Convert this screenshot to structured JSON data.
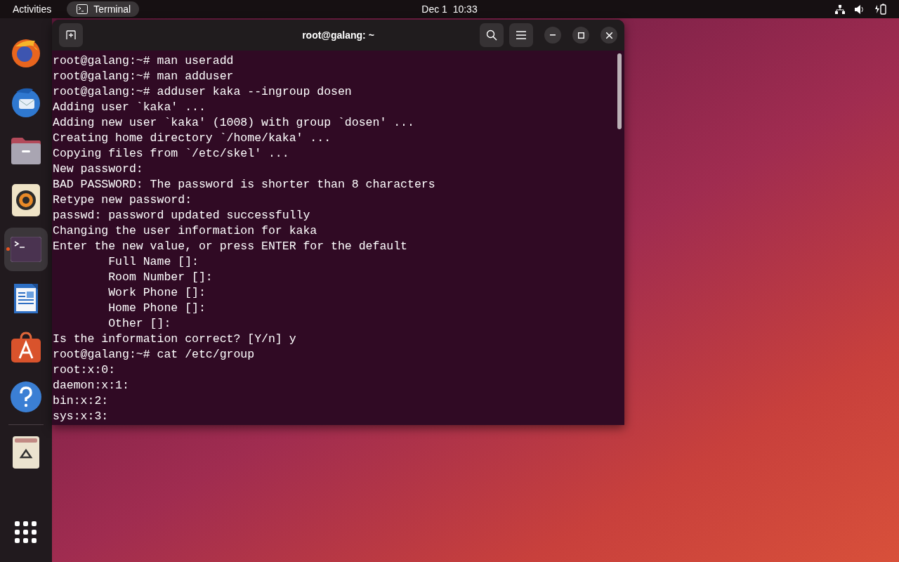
{
  "top_bar": {
    "activities": "Activities",
    "app": {
      "name": "Terminal"
    },
    "clock": "Dec 1  10:33"
  },
  "dock": {
    "items": [
      {
        "kind": "browser",
        "running": false,
        "selected": false
      },
      {
        "kind": "mail",
        "running": false,
        "selected": false
      },
      {
        "kind": "files",
        "running": false,
        "selected": false
      },
      {
        "kind": "music",
        "running": false,
        "selected": false
      },
      {
        "kind": "terminal",
        "running": true,
        "selected": true
      },
      {
        "kind": "writer",
        "running": false,
        "selected": false
      },
      {
        "kind": "store",
        "running": false,
        "selected": false
      },
      {
        "kind": "help",
        "running": false,
        "selected": false
      },
      {
        "kind": "trash",
        "running": false,
        "selected": false
      }
    ]
  },
  "window": {
    "title": "root@galang: ~",
    "lines": [
      "root@galang:~# man useradd",
      "root@galang:~# man adduser",
      "root@galang:~# adduser kaka --ingroup dosen",
      "Adding user `kaka' ...",
      "Adding new user `kaka' (1008) with group `dosen' ...",
      "Creating home directory `/home/kaka' ...",
      "Copying files from `/etc/skel' ...",
      "New password:",
      "BAD PASSWORD: The password is shorter than 8 characters",
      "Retype new password:",
      "passwd: password updated successfully",
      "Changing the user information for kaka",
      "Enter the new value, or press ENTER for the default",
      "        Full Name []:",
      "        Room Number []:",
      "        Work Phone []:",
      "        Home Phone []:",
      "        Other []:",
      "Is the information correct? [Y/n] y",
      "root@galang:~# cat /etc/group",
      "root:x:0:",
      "daemon:x:1:",
      "bin:x:2:",
      "sys:x:3:"
    ]
  }
}
